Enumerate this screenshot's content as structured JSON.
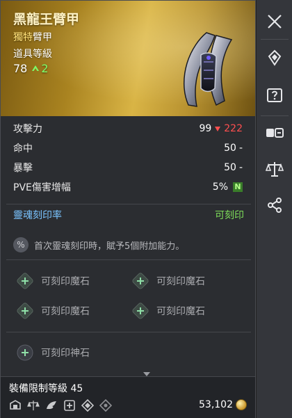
{
  "item": {
    "name": "黑龍王臂甲",
    "grade_word": "獨特",
    "type_word": "臂甲",
    "level_label": "道具等級",
    "level": "78",
    "level_up": "2"
  },
  "stats": [
    {
      "label": "攻擊力",
      "value": "99",
      "diff": "222",
      "diff_dir": "down"
    },
    {
      "label": "命中",
      "value": "50",
      "diff": "-",
      "diff_dir": "none"
    },
    {
      "label": "暴擊",
      "value": "50",
      "diff": "-",
      "diff_dir": "none"
    },
    {
      "label": "PVE傷害增幅",
      "value": "5%",
      "badge": "N"
    }
  ],
  "soul": {
    "label": "靈魂刻印率",
    "status": "可刻印",
    "desc": "首次靈魂刻印時，賦予5個附加能力。",
    "desc_icon": "%"
  },
  "slots": {
    "mana1": "可刻印魔石",
    "mana2": "可刻印魔石",
    "mana3": "可刻印魔石",
    "mana4": "可刻印魔石",
    "god": "可刻印神石"
  },
  "footer": {
    "req_label": "裝備限制等級",
    "req_level": "45",
    "price": "53,102"
  },
  "sidebar": {
    "icons": [
      "close-icon",
      "gem-icon",
      "unknown-item-icon",
      "compare-icon",
      "scales-icon",
      "share-icon"
    ]
  },
  "colors": {
    "header_gold": "#b89230",
    "stat_decrease": "#ff4f4f",
    "soul_label": "#7ac4ff",
    "soul_status": "#7fe05a",
    "level_up": "#7dff6a"
  }
}
